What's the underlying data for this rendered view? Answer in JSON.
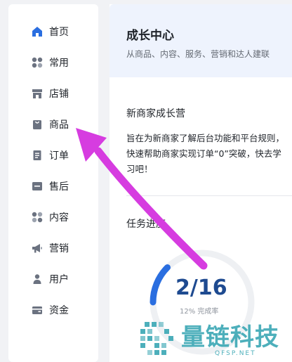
{
  "sidebar": {
    "items": [
      {
        "label": "首页",
        "icon": "home-icon",
        "active": true
      },
      {
        "label": "常用",
        "icon": "grid-icon"
      },
      {
        "label": "店铺",
        "icon": "store-icon"
      },
      {
        "label": "商品",
        "icon": "bag-icon"
      },
      {
        "label": "订单",
        "icon": "order-icon"
      },
      {
        "label": "售后",
        "icon": "aftersale-icon"
      },
      {
        "label": "内容",
        "icon": "content-icon"
      },
      {
        "label": "营销",
        "icon": "megaphone-icon"
      },
      {
        "label": "用户",
        "icon": "user-icon"
      },
      {
        "label": "资金",
        "icon": "wallet-icon"
      }
    ]
  },
  "banner": {
    "title": "成长中心",
    "subtitle": "从商品、内容、服务、营销和达人建联"
  },
  "camp": {
    "title": "新商家成长营",
    "description": "旨在为新商家了解后台功能和平台规则，快速帮助商家实现订单“0”突破，快去学习吧！"
  },
  "tasks": {
    "title": "任务进度",
    "progress": "2/16",
    "progress_fraction": 0.125,
    "completion": "12% 完成率"
  },
  "watermark": {
    "text": "量链科技",
    "url": "QFSP.NET"
  },
  "colors": {
    "accent": "#2a6ee0",
    "arrow": "#d63ce0",
    "banner_bg": "#eef3fd",
    "watermark": "#3aa7b4"
  }
}
